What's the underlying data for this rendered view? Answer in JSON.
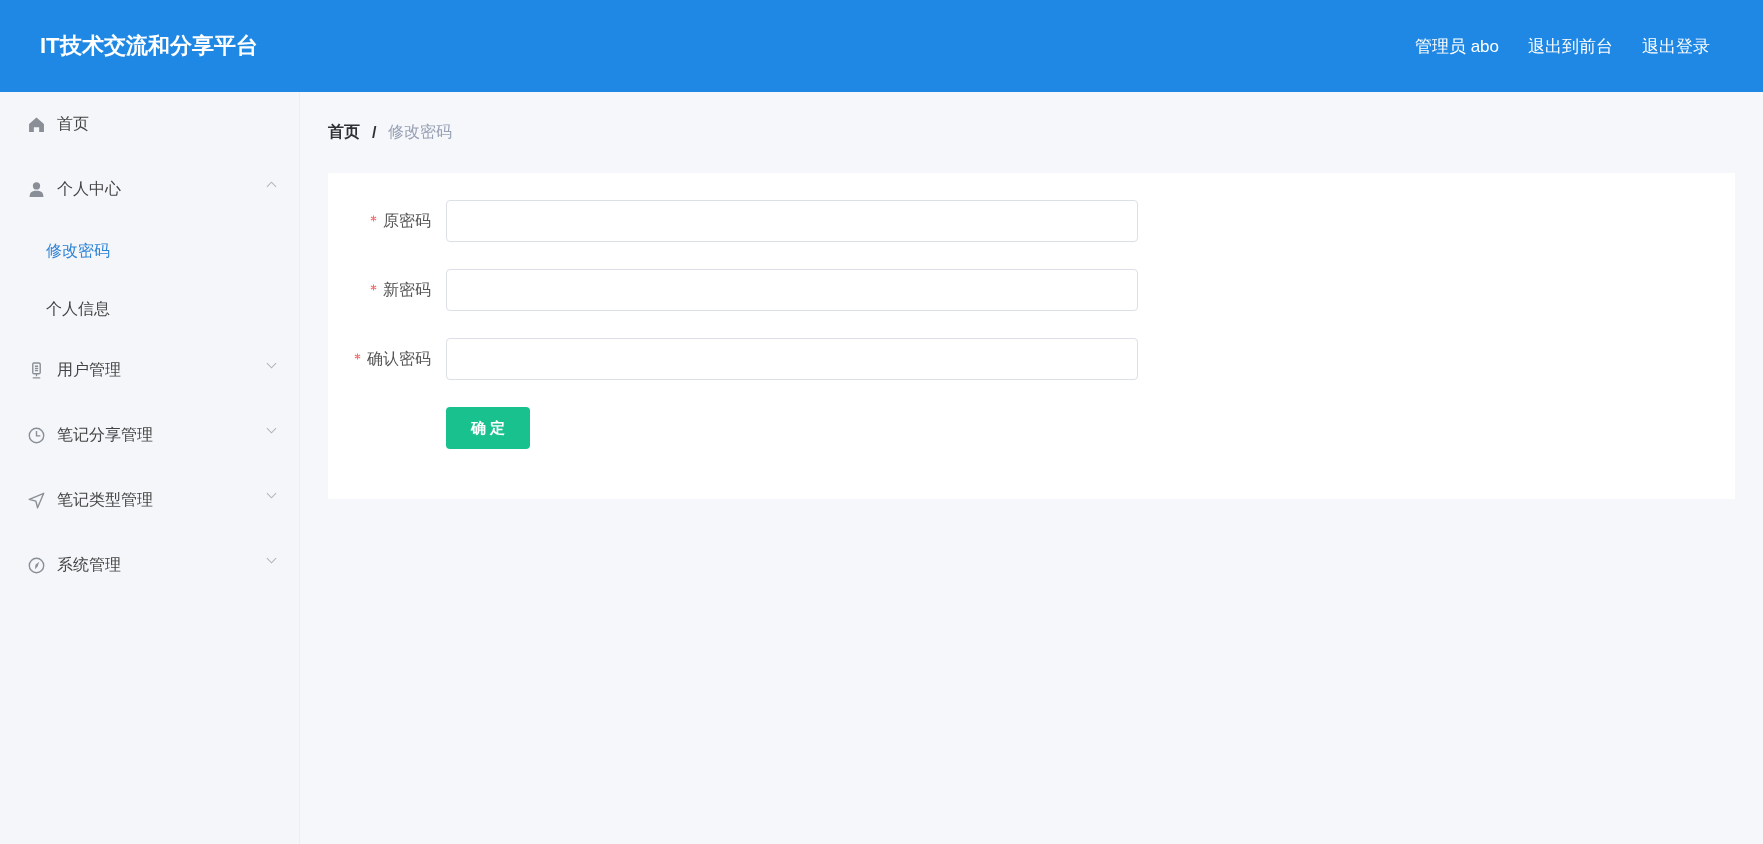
{
  "header": {
    "title": "IT技术交流和分享平台",
    "links": [
      {
        "label": "管理员 abo"
      },
      {
        "label": "退出到前台"
      },
      {
        "label": "退出登录"
      }
    ]
  },
  "sidebar": {
    "items": [
      {
        "label": "首页",
        "selected": false
      },
      {
        "label": "个人中心",
        "expanded": true,
        "children": [
          {
            "label": "修改密码",
            "selected": true
          },
          {
            "label": "个人信息",
            "selected": false
          }
        ]
      },
      {
        "label": "用户管理",
        "expanded": false
      },
      {
        "label": "笔记分享管理",
        "expanded": false
      },
      {
        "label": "笔记类型管理",
        "expanded": false
      },
      {
        "label": "系统管理",
        "expanded": false
      }
    ]
  },
  "breadcrumb": {
    "separator": "/",
    "items": [
      {
        "label": "首页",
        "current": false
      },
      {
        "label": "修改密码",
        "current": true
      }
    ]
  },
  "form": {
    "fields": [
      {
        "label": "原密码",
        "required": true
      },
      {
        "label": "新密码",
        "required": true
      },
      {
        "label": "确认密码",
        "required": true
      }
    ],
    "submit": {
      "label": "确 定"
    }
  }
}
